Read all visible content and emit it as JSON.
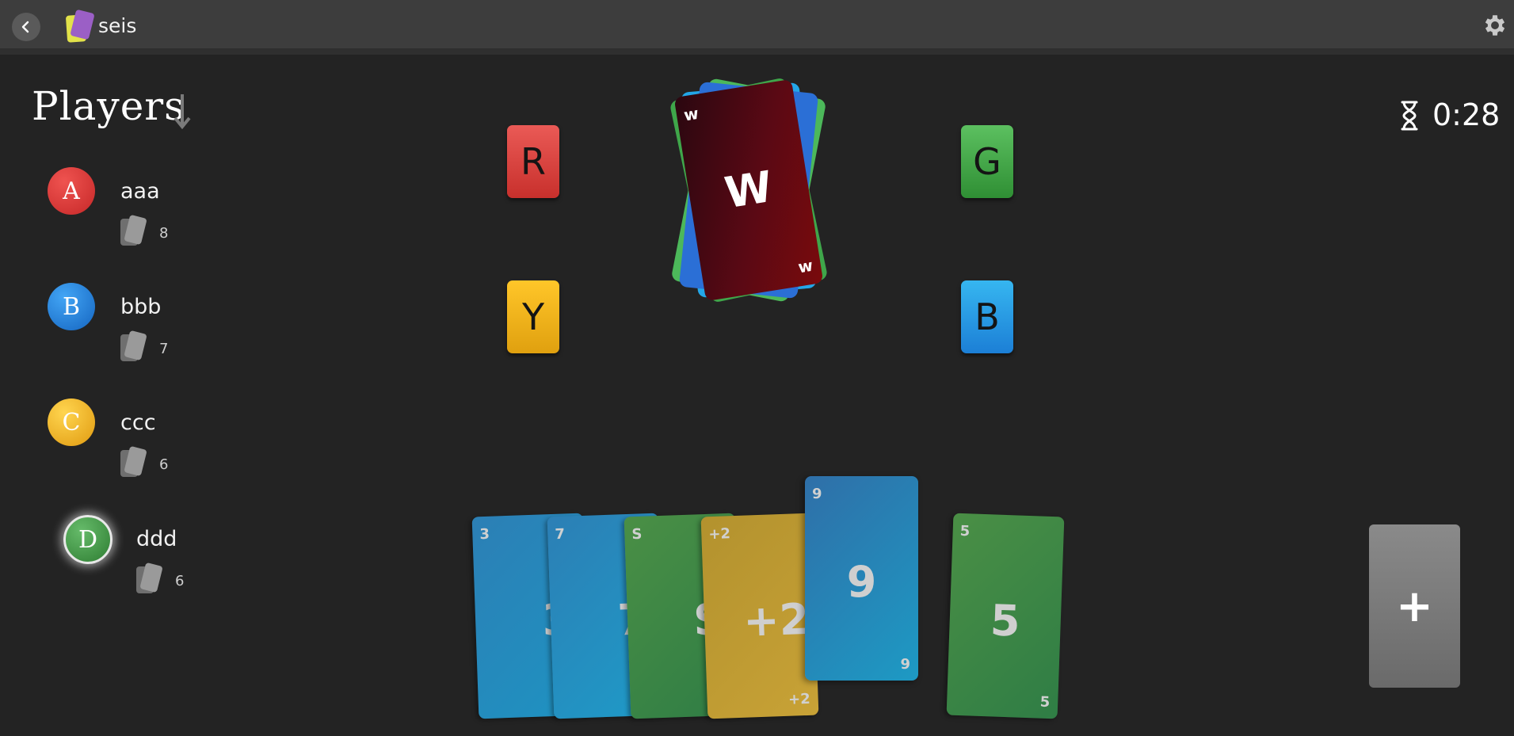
{
  "header": {
    "title": "seis",
    "back_icon": "chevron-left-icon",
    "settings_icon": "gear-icon"
  },
  "players_panel": {
    "title": "Players",
    "sort_icon": "arrow-down-icon",
    "players": [
      {
        "initial": "A",
        "name": "aaa",
        "card_count": "8",
        "color": "#d32f2f",
        "active": false
      },
      {
        "initial": "B",
        "name": "bbb",
        "card_count": "7",
        "color": "#1e88e5",
        "active": false
      },
      {
        "initial": "C",
        "name": "ccc",
        "card_count": "6",
        "color": "#f2b01e",
        "active": false
      },
      {
        "initial": "D",
        "name": "ddd",
        "card_count": "6",
        "color": "#43a047",
        "active": true
      }
    ]
  },
  "timer": {
    "icon": "hourglass-icon",
    "value": "0:28"
  },
  "color_picker": {
    "red": "R",
    "green": "G",
    "yellow": "Y",
    "blue": "B",
    "colors": {
      "red": "#e04a4a",
      "green": "#43a047",
      "yellow": "#f2b01e",
      "blue": "#1e88e5"
    }
  },
  "discard_pile": {
    "top_card": {
      "corner": "w",
      "center": "W",
      "color": "#5c0d14"
    }
  },
  "hand": [
    {
      "value": "3",
      "color": "blue"
    },
    {
      "value": "7",
      "color": "blue"
    },
    {
      "value": "S",
      "color": "green"
    },
    {
      "value": "+2",
      "color": "yellow"
    },
    {
      "value": "9",
      "color": "blue",
      "raised": true
    },
    {
      "value": "5",
      "color": "green"
    }
  ],
  "draw_button": {
    "label": "+"
  }
}
